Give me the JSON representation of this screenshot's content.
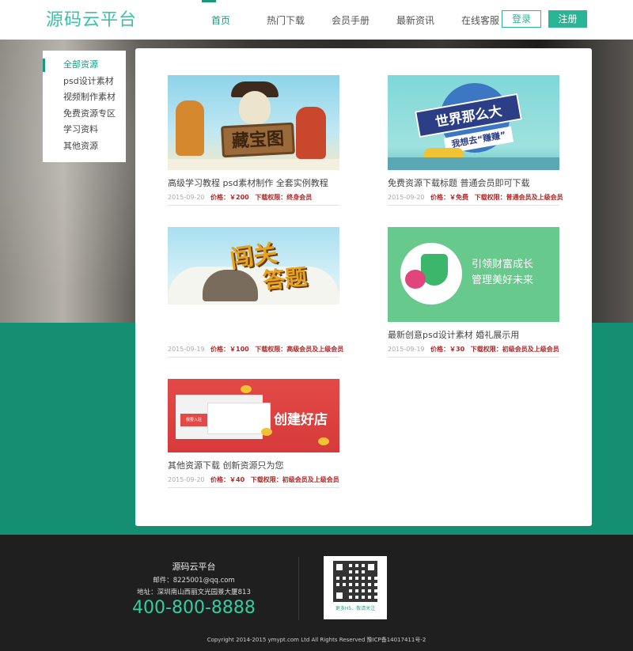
{
  "header": {
    "logo_text": "源码云平台",
    "nav": [
      {
        "label": "首页",
        "active": true
      },
      {
        "label": "热门下载",
        "active": false
      },
      {
        "label": "会员手册",
        "active": false
      },
      {
        "label": "最新资讯",
        "active": false
      },
      {
        "label": "在线客服",
        "active": false
      }
    ],
    "login_label": "登录",
    "register_label": "注册"
  },
  "sidebar": {
    "items": [
      {
        "label": "全部资源",
        "active": true
      },
      {
        "label": "psd设计素材",
        "active": false
      },
      {
        "label": "视频制作素材",
        "active": false
      },
      {
        "label": "免费资源专区",
        "active": false
      },
      {
        "label": "学习资料",
        "active": false
      },
      {
        "label": "其他资源",
        "active": false
      }
    ]
  },
  "cards": [
    {
      "image_text": "藏宝图",
      "title": "高级学习教程 psd素材制作 全套实例教程",
      "date": "2015-09-20",
      "price": "价格：￥200",
      "permission": "下载权限：终身会员"
    },
    {
      "image_text": "世界那么大",
      "image_text2": "我想去“赚赚”",
      "title": "免费资源下载标题 普通会员即可下载",
      "date": "2015-09-20",
      "price": "价格：￥免费",
      "permission": "下载权限：普通会员及上级会员"
    },
    {
      "image_text": "闯关",
      "image_text2": "答题",
      "title": "",
      "date": "2015-09-19",
      "price": "价格：￥100",
      "permission": "下载权限：高级会员及上级会员"
    },
    {
      "image_text": "引领财富成长",
      "image_text2": "管理美好未来",
      "title": "最新创意psd设计素材 婚礼展示用",
      "date": "2015-09-19",
      "price": "价格：￥30",
      "permission": "下载权限：初级会员及上级会员"
    },
    {
      "image_text": "创建好店",
      "image_text2": "我要入驻",
      "title": "其他资源下载 创新资源只为您",
      "date": "2015-09-20",
      "price": "价格：￥40",
      "permission": "下载权限：初级会员及上级会员"
    }
  ],
  "footer": {
    "name": "源码云平台",
    "email": "邮件：8225001@qq.com",
    "address": "地址：深圳南山西丽文光园景大厦813",
    "phone": "400-800-8888",
    "qr_caption": "更多H5、敬请关注",
    "copyright": "Copyright 2014-2015 ymypt.com Ltd All Rights Reserved 豫ICP备14017411号-2"
  },
  "colors": {
    "accent": "#1a9a7c",
    "button": "#2bb596",
    "band": "#148f72",
    "price": "#b42525",
    "footer_bg": "#1f1f1f",
    "phone": "#2fcfa1"
  }
}
